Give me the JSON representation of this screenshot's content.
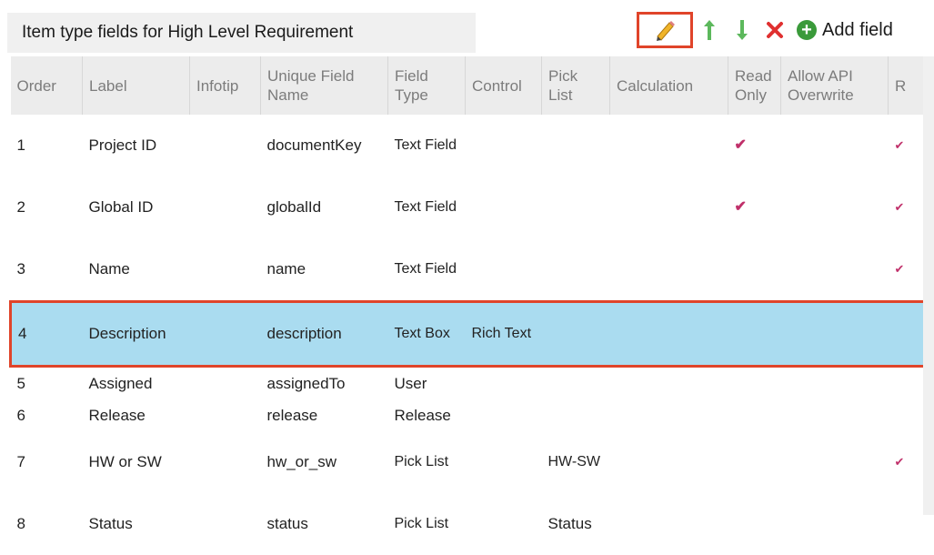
{
  "header": {
    "title": "Item type fields for High Level Requirement",
    "add_label": "Add field"
  },
  "columns": [
    "Order",
    "Label",
    "Infotip",
    "Unique Field Name",
    "Field Type",
    "Control",
    "Pick List",
    "Calculation",
    "Read Only",
    "Allow API Overwrite",
    "R"
  ],
  "rows": [
    {
      "order": "1",
      "label": "Project ID",
      "infotip": "",
      "unique": "documentKey",
      "type": "Text Field",
      "control": "",
      "picklist": "",
      "calc": "",
      "readonly": "✔",
      "api": "",
      "r": "✔",
      "selected": false
    },
    {
      "order": "2",
      "label": "Global ID",
      "infotip": "",
      "unique": "globalId",
      "type": "Text Field",
      "control": "",
      "picklist": "",
      "calc": "",
      "readonly": "✔",
      "api": "",
      "r": "✔",
      "selected": false
    },
    {
      "order": "3",
      "label": "Name",
      "infotip": "",
      "unique": "name",
      "type": "Text Field",
      "control": "",
      "picklist": "",
      "calc": "",
      "readonly": "",
      "api": "",
      "r": "✔",
      "selected": false
    },
    {
      "order": "4",
      "label": "Description",
      "infotip": "",
      "unique": "description",
      "type": "Text Box",
      "control": "Rich Text",
      "picklist": "",
      "calc": "",
      "readonly": "",
      "api": "",
      "r": "",
      "selected": true
    },
    {
      "order": "5",
      "label": "Assigned",
      "infotip": "",
      "unique": "assignedTo",
      "type": "User",
      "control": "",
      "picklist": "",
      "calc": "",
      "readonly": "",
      "api": "",
      "r": "",
      "selected": false
    },
    {
      "order": "6",
      "label": "Release",
      "infotip": "",
      "unique": "release",
      "type": "Release",
      "control": "",
      "picklist": "",
      "calc": "",
      "readonly": "",
      "api": "",
      "r": "",
      "selected": false
    },
    {
      "order": "7",
      "label": "HW or SW",
      "infotip": "",
      "unique": "hw_or_sw",
      "type": "Pick List",
      "control": "",
      "picklist": "HW-SW",
      "calc": "",
      "readonly": "",
      "api": "",
      "r": "✔",
      "selected": false
    },
    {
      "order": "8",
      "label": "Status",
      "infotip": "",
      "unique": "status",
      "type": "Pick List",
      "control": "",
      "picklist": "Status",
      "calc": "",
      "readonly": "",
      "api": "",
      "r": "",
      "selected": false
    }
  ],
  "icons": {
    "edit": "pencil-icon",
    "up": "arrow-up-icon",
    "down": "arrow-down-icon",
    "delete": "delete-x-icon",
    "add": "add-circle-icon"
  },
  "colors": {
    "selected_row": "#aadcf0",
    "highlight_border": "#e0442a",
    "check": "#c0306a",
    "arrow": "#5cb85c",
    "delete": "#e03030",
    "add": "#3a9a3a"
  }
}
